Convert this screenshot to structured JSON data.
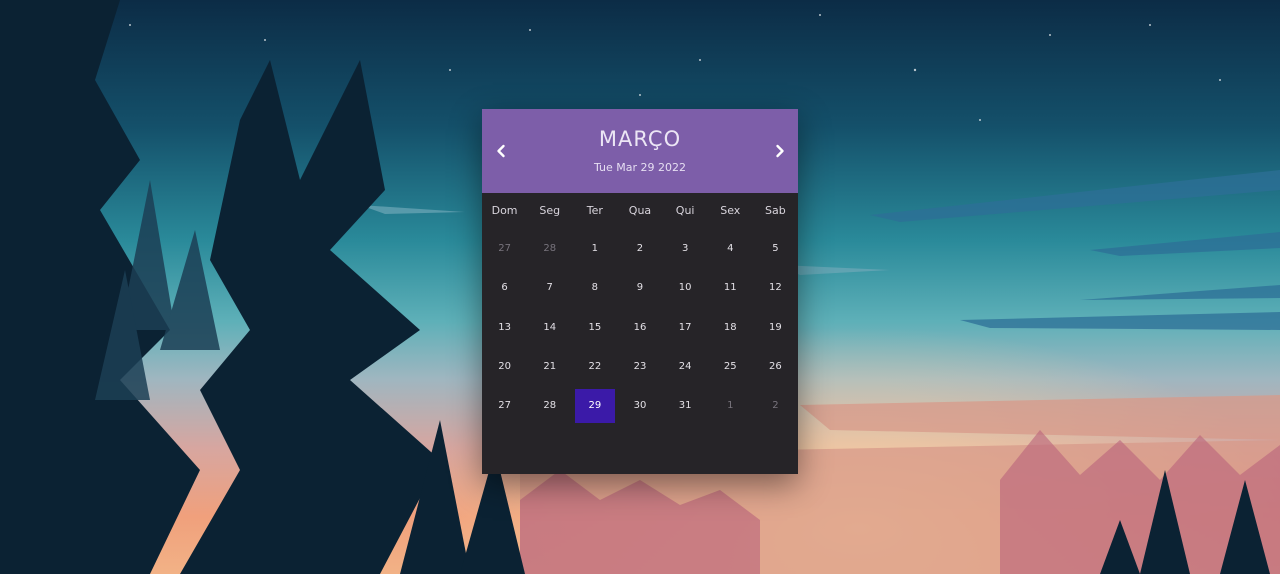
{
  "calendar": {
    "month": "MARÇO",
    "current_date": "Tue Mar 29 2022",
    "weekdays": [
      "Dom",
      "Seg",
      "Ter",
      "Qua",
      "Qui",
      "Sex",
      "Sab"
    ],
    "days": [
      {
        "label": "27",
        "other": true
      },
      {
        "label": "28",
        "other": true
      },
      {
        "label": "1"
      },
      {
        "label": "2"
      },
      {
        "label": "3"
      },
      {
        "label": "4"
      },
      {
        "label": "5"
      },
      {
        "label": "6"
      },
      {
        "label": "7"
      },
      {
        "label": "8"
      },
      {
        "label": "9"
      },
      {
        "label": "10"
      },
      {
        "label": "11"
      },
      {
        "label": "12"
      },
      {
        "label": "13"
      },
      {
        "label": "14"
      },
      {
        "label": "15"
      },
      {
        "label": "16"
      },
      {
        "label": "17"
      },
      {
        "label": "18"
      },
      {
        "label": "19"
      },
      {
        "label": "20"
      },
      {
        "label": "21"
      },
      {
        "label": "22"
      },
      {
        "label": "23"
      },
      {
        "label": "24"
      },
      {
        "label": "25"
      },
      {
        "label": "26"
      },
      {
        "label": "27"
      },
      {
        "label": "28"
      },
      {
        "label": "29",
        "today": true
      },
      {
        "label": "30"
      },
      {
        "label": "31"
      },
      {
        "label": "1",
        "other": true
      },
      {
        "label": "2",
        "other": true
      }
    ],
    "prev_icon": "chevron-left-icon",
    "next_icon": "chevron-right-icon",
    "colors": {
      "header": "#7d5ea9",
      "body": "#262428",
      "today_highlight": "#3b1aa8"
    }
  }
}
